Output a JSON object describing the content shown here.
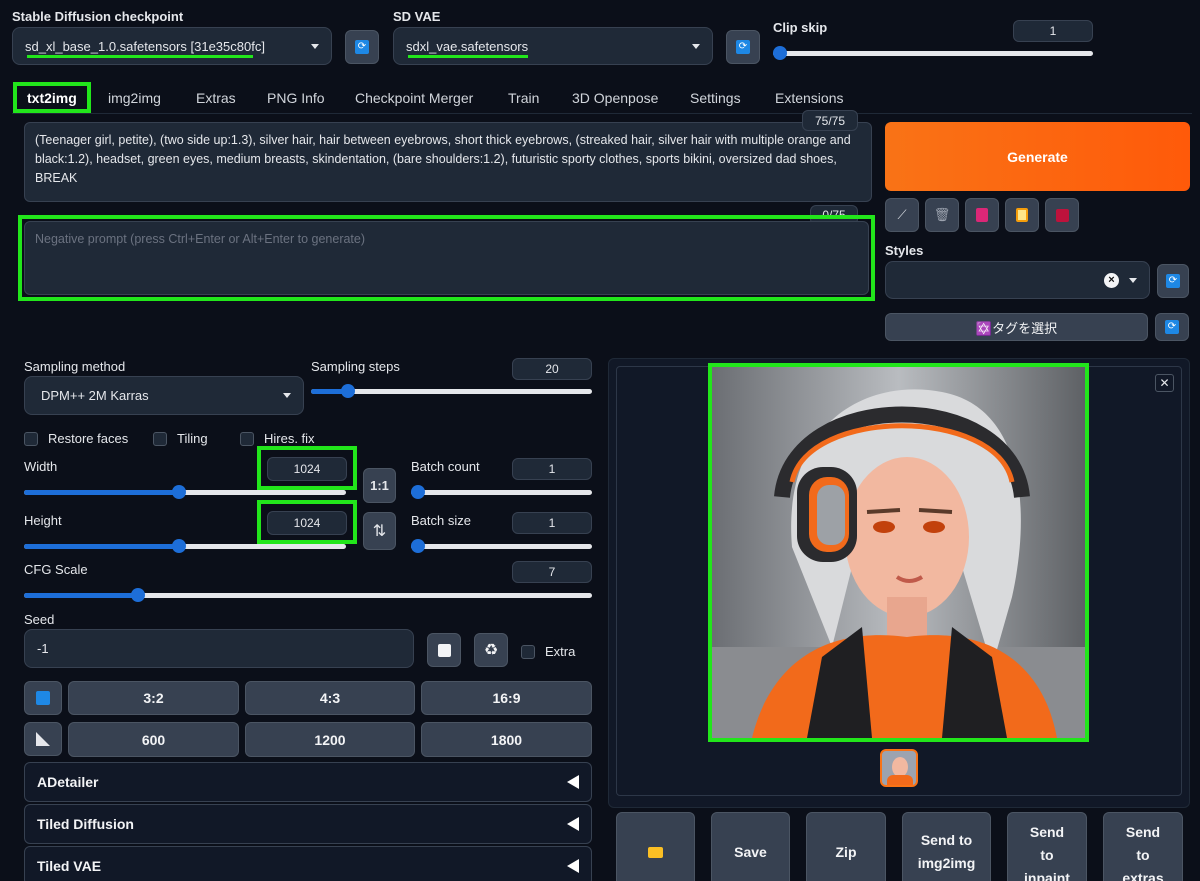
{
  "header": {
    "checkpoint_label": "Stable Diffusion checkpoint",
    "checkpoint_value": "sd_xl_base_1.0.safetensors [31e35c80fc]",
    "vae_label": "SD VAE",
    "vae_value": "sdxl_vae.safetensors",
    "clip_skip_label": "Clip skip",
    "clip_skip_value": "1"
  },
  "tabs": [
    "txt2img",
    "img2img",
    "Extras",
    "PNG Info",
    "Checkpoint Merger",
    "Train",
    "3D Openpose",
    "Settings",
    "Extensions"
  ],
  "prompt": {
    "token_count": "75/75",
    "text": "(Teenager girl, petite), (two side up:1.3), silver hair, hair between eyebrows, short thick eyebrows, (streaked hair, silver hair with multiple orange and black:1.2), headset, green eyes, medium breasts, skindentation, (bare shoulders:1.2), futuristic sporty clothes, sports bikini, oversized dad shoes, BREAK",
    "neg_token_count": "0/75",
    "neg_placeholder": "Negative prompt (press Ctrl+Enter or Alt+Enter to generate)"
  },
  "generate_label": "Generate",
  "styles": {
    "label": "Styles",
    "tag_button": "✡️タグを選択"
  },
  "sampling": {
    "method_label": "Sampling method",
    "method_value": "DPM++ 2M Karras",
    "steps_label": "Sampling steps",
    "steps_value": "20",
    "steps_fraction": 0.13
  },
  "checks": {
    "restore": "Restore faces",
    "tiling": "Tiling",
    "hires": "Hires. fix",
    "extra": "Extra"
  },
  "size": {
    "width_label": "Width",
    "width_value": "1024",
    "width_fraction": 0.48,
    "height_label": "Height",
    "height_value": "1024",
    "height_fraction": 0.48,
    "ratio_button": "1:1",
    "swap_button": "⇅"
  },
  "batch": {
    "count_label": "Batch count",
    "count_value": "1",
    "size_label": "Batch size",
    "size_value": "1"
  },
  "cfg": {
    "label": "CFG Scale",
    "value": "7",
    "fraction": 0.2
  },
  "seed": {
    "label": "Seed",
    "value": "-1"
  },
  "aspect_buttons": [
    "3:2",
    "4:3",
    "16:9"
  ],
  "res_buttons": [
    "600",
    "1200",
    "1800"
  ],
  "accordions": [
    "ADetailer",
    "Tiled Diffusion",
    "Tiled VAE"
  ],
  "output_actions": [
    {
      "line1": "",
      "line2": ""
    },
    {
      "line1": "Save",
      "line2": ""
    },
    {
      "line1": "Zip",
      "line2": ""
    },
    {
      "line1": "Send to",
      "line2": "img2img"
    },
    {
      "line1": "Send",
      "line2": "to",
      "line3": "inpaint"
    },
    {
      "line1": "Send",
      "line2": "to",
      "line3": "extras"
    }
  ],
  "colors": {
    "accent": "#1d6ed8",
    "generate": "#f97316",
    "highlight": "#22e61b",
    "bg": "#0b0f19"
  }
}
